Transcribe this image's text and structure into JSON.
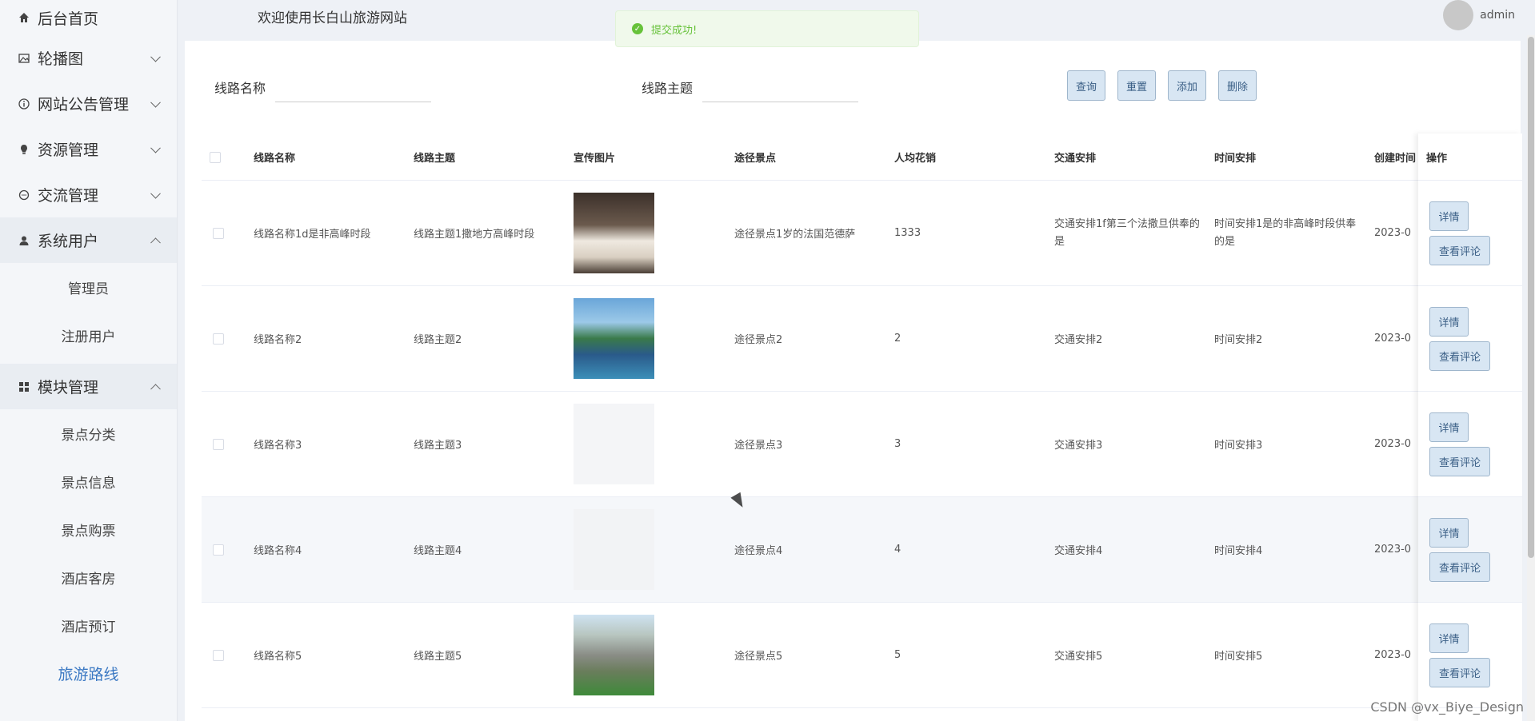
{
  "header": {
    "welcome": "欢迎使用长白山旅游网站",
    "user_name": "admin"
  },
  "toast": {
    "message": "提交成功!"
  },
  "sidebar": {
    "items": [
      {
        "label": "后台首页",
        "icon": "home-icon"
      },
      {
        "label": "轮播图",
        "icon": "image-icon"
      },
      {
        "label": "网站公告管理",
        "icon": "info-icon"
      },
      {
        "label": "资源管理",
        "icon": "bulb-icon"
      },
      {
        "label": "交流管理",
        "icon": "chat-icon"
      },
      {
        "label": "系统用户",
        "icon": "user-icon"
      },
      {
        "label": "模块管理",
        "icon": "grid-icon"
      }
    ],
    "system_users_sub": [
      "管理员",
      "注册用户"
    ],
    "module_sub": [
      "景点分类",
      "景点信息",
      "景点购票",
      "酒店客房",
      "酒店预订",
      "旅游路线"
    ]
  },
  "search": {
    "route_name_label": "线路名称",
    "route_name_value": "",
    "route_theme_label": "线路主题",
    "route_theme_value": "",
    "query": "查询",
    "reset": "重置",
    "add": "添加",
    "delete": "删除"
  },
  "table": {
    "headers": {
      "name": "线路名称",
      "theme": "线路主题",
      "image": "宣传图片",
      "spots": "途径景点",
      "cost": "人均花销",
      "traffic": "交通安排",
      "time": "时间安排",
      "created": "创建时间",
      "ops": "操作"
    },
    "rows": [
      {
        "name": "线路名称1d是非高峰时段",
        "theme": "线路主题1撒地方高峰时段",
        "image": "hotel-room-photo",
        "spots": "途径景点1岁的法国范德萨",
        "cost": "1333",
        "traffic": "交通安排1f第三个法撒旦供奉的是",
        "time": "时间安排1是的非高峰时段供奉的是",
        "created": "2023-0"
      },
      {
        "name": "线路名称2",
        "theme": "线路主题2",
        "image": "pool-photo",
        "spots": "途径景点2",
        "cost": "2",
        "traffic": "交通安排2",
        "time": "时间安排2",
        "created": "2023-0"
      },
      {
        "name": "线路名称3",
        "theme": "线路主题3",
        "image": "blank",
        "spots": "途径景点3",
        "cost": "3",
        "traffic": "交通安排3",
        "time": "时间安排3",
        "created": "2023-0"
      },
      {
        "name": "线路名称4",
        "theme": "线路主题4",
        "image": "blank",
        "spots": "途径景点4",
        "cost": "4",
        "traffic": "交通安排4",
        "time": "时间安排4",
        "created": "2023-0"
      },
      {
        "name": "线路名称5",
        "theme": "线路主题5",
        "image": "mountain-photo",
        "spots": "途径景点5",
        "cost": "5",
        "traffic": "交通安排5",
        "time": "时间安排5",
        "created": "2023-0"
      }
    ],
    "detail_btn": "详情",
    "comment_btn": "查看评论"
  },
  "watermark": "CSDN @vx_Biye_Design",
  "colors": {
    "accent": "#3a78c3",
    "button_bg": "#d8e6f3",
    "success": "#67c23a"
  }
}
